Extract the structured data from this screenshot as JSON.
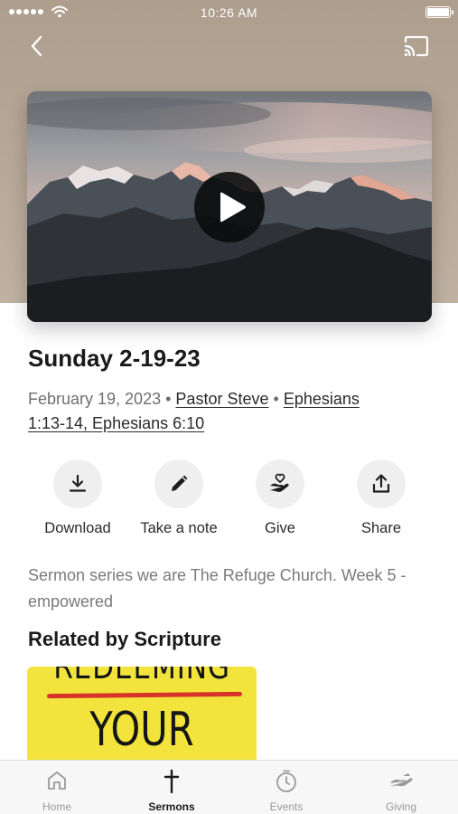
{
  "status_bar": {
    "time": "10:26 AM"
  },
  "sermon": {
    "title": "Sunday 2-19-23",
    "date": "February 19, 2023",
    "speaker": "Pastor Steve",
    "scripture_line1": "Ephesians",
    "scripture_line2": "1:13-14, Ephesians 6:10",
    "description": "Sermon series we are The Refuge Church.   Week 5 -empowered"
  },
  "actions": [
    {
      "label": "Download",
      "icon": "download-icon"
    },
    {
      "label": "Take a note",
      "icon": "pencil-icon"
    },
    {
      "label": "Give",
      "icon": "heart-hand-icon"
    },
    {
      "label": "Share",
      "icon": "share-icon"
    }
  ],
  "related": {
    "title": "Related by Scripture",
    "book_cover_text_top": "REDEEMING",
    "book_cover_text_main": "YOUR"
  },
  "tabs": [
    {
      "label": "Home",
      "icon": "home-icon",
      "active": false
    },
    {
      "label": "Sermons",
      "icon": "cross-icon",
      "active": true
    },
    {
      "label": "Events",
      "icon": "clock-icon",
      "active": false
    },
    {
      "label": "Giving",
      "icon": "giving-hand-icon",
      "active": false
    }
  ],
  "colors": {
    "hero_bg": "#ae9e8d",
    "book_yellow": "#f2e43c",
    "book_red_line": "#d8332a"
  }
}
